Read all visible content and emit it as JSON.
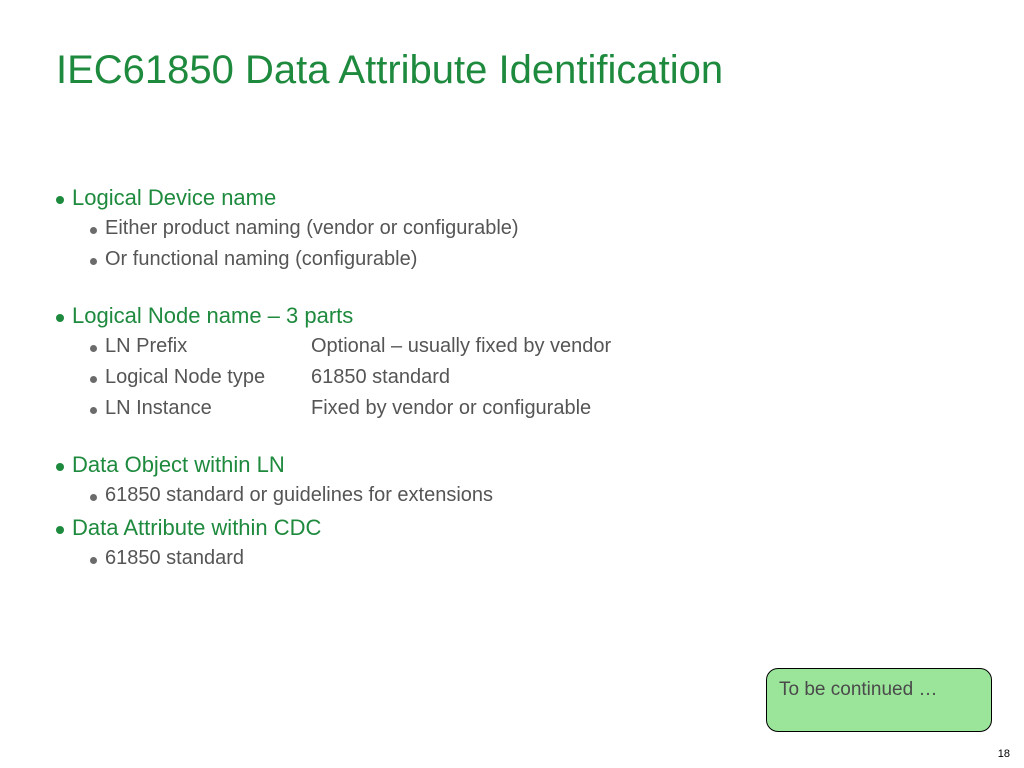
{
  "title": "IEC61850 Data Attribute Identification",
  "sections": [
    {
      "heading": "Logical Device name",
      "items": [
        {
          "text": "Either product naming (vendor or configurable)"
        },
        {
          "text": "Or functional naming (configurable)"
        }
      ],
      "tight": false
    },
    {
      "heading": "Logical Node name – 3 parts",
      "items": [
        {
          "col1": "LN Prefix",
          "col2": "Optional – usually fixed by vendor"
        },
        {
          "col1": "Logical Node type",
          "col2": "61850 standard"
        },
        {
          "col1": "LN Instance",
          "col2": "Fixed by vendor or configurable"
        }
      ],
      "tight": false
    },
    {
      "heading": "Data Object  within LN",
      "items": [
        {
          "text": "61850 standard or guidelines for extensions"
        }
      ],
      "tight": true
    },
    {
      "heading": "Data Attribute within CDC",
      "items": [
        {
          "text": "61850 standard"
        }
      ],
      "tight": true
    }
  ],
  "callout": "To be continued …",
  "page_number": "18"
}
